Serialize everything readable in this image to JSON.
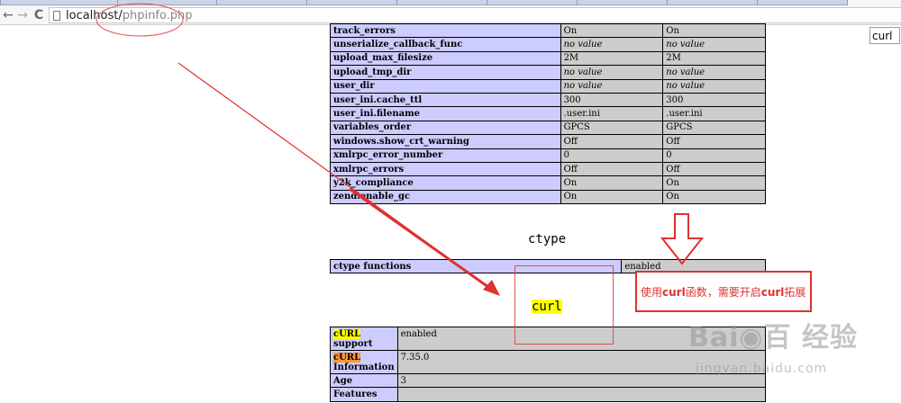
{
  "browser": {
    "url_host": "localhost/",
    "url_path": "phpinfo.php",
    "back_glyph": "←",
    "forward_glyph": "→",
    "reload_glyph": "C"
  },
  "find_bar": {
    "value": "curl"
  },
  "directives": [
    {
      "name": "track_errors",
      "local": "On",
      "master": "On",
      "nv": false
    },
    {
      "name": "unserialize_callback_func",
      "local": "no value",
      "master": "no value",
      "nv": true
    },
    {
      "name": "upload_max_filesize",
      "local": "2M",
      "master": "2M",
      "nv": false
    },
    {
      "name": "upload_tmp_dir",
      "local": "no value",
      "master": "no value",
      "nv": true
    },
    {
      "name": "user_dir",
      "local": "no value",
      "master": "no value",
      "nv": true
    },
    {
      "name": "user_ini.cache_ttl",
      "local": "300",
      "master": "300",
      "nv": false
    },
    {
      "name": "user_ini.filename",
      "local": ".user.ini",
      "master": ".user.ini",
      "nv": false
    },
    {
      "name": "variables_order",
      "local": "GPCS",
      "master": "GPCS",
      "nv": false
    },
    {
      "name": "windows.show_crt_warning",
      "local": "Off",
      "master": "Off",
      "nv": false
    },
    {
      "name": "xmlrpc_error_number",
      "local": "0",
      "master": "0",
      "nv": false
    },
    {
      "name": "xmlrpc_errors",
      "local": "Off",
      "master": "Off",
      "nv": false
    },
    {
      "name": "y2k_compliance",
      "local": "On",
      "master": "On",
      "nv": false
    },
    {
      "name": "zend.enable_gc",
      "local": "On",
      "master": "On",
      "nv": false
    }
  ],
  "ctype": {
    "heading": "ctype",
    "row_label": "ctype functions",
    "row_value": "enabled"
  },
  "curl": {
    "heading": "curl",
    "rows": [
      {
        "hl": "cURL",
        "label_rest": "support",
        "value": "enabled"
      },
      {
        "hl": "cURL",
        "label_rest": "Information",
        "value": "7.35.0"
      },
      {
        "hl": "",
        "label_rest": "Age",
        "value": "3"
      },
      {
        "hl": "",
        "label_rest": "Features",
        "value": ""
      }
    ]
  },
  "annotation": {
    "prefix": "使用",
    "kw1": "curl",
    "middle": "函数，需要开启",
    "kw2": "curl",
    "suffix": "拓展",
    "color": "#e03030"
  },
  "watermark": {
    "main": "Bai◉百 经验",
    "sub": "jingyan.baidu.com"
  }
}
